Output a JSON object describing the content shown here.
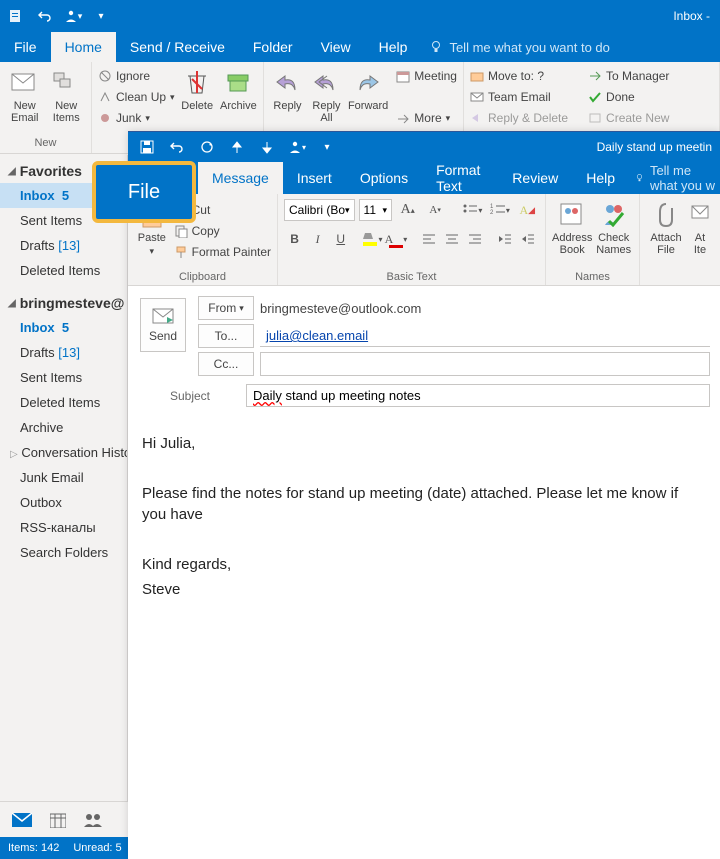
{
  "main_title": "Inbox - ",
  "main_tabs": {
    "file": "File",
    "home": "Home",
    "sendreceive": "Send / Receive",
    "folder": "Folder",
    "view": "View",
    "help": "Help",
    "tellme": "Tell me what you want to do"
  },
  "ribbon": {
    "new_email": "New\nEmail",
    "new_items": "New\nItems",
    "new": "New",
    "ignore": "Ignore",
    "cleanup": "Clean Up",
    "junk": "Junk",
    "delete": "Delete",
    "archive": "Archive",
    "reply": "Reply",
    "replyall": "Reply\nAll",
    "forward": "Forward",
    "meeting": "Meeting",
    "more": "More",
    "moveto": "Move to: ?",
    "teamemail": "Team Email",
    "replyd": "Reply & Delete",
    "tomanager": "To Manager",
    "done": "Done",
    "createnew": "Create New"
  },
  "sidebar": {
    "favorites": "Favorites",
    "inbox": "Inbox",
    "inbox_count": "5",
    "sent": "Sent Items",
    "drafts": "Drafts",
    "drafts_count": "[13]",
    "deleted": "Deleted Items",
    "account": "bringmesteve@",
    "archive": "Archive",
    "convhist": "Conversation Histor",
    "junk": "Junk Email",
    "outbox": "Outbox",
    "rss": "RSS-каналы",
    "search": "Search Folders"
  },
  "status": {
    "items": "Items: 142",
    "unread": "Unread: 5"
  },
  "callout": "File",
  "compose": {
    "title": "Daily stand up meetin",
    "tabs": {
      "file": "File",
      "message": "Message",
      "insert": "Insert",
      "options": "Options",
      "formattext": "Format Text",
      "review": "Review",
      "help": "Help",
      "tellme": "Tell me what you w"
    },
    "ribbon": {
      "paste": "Paste",
      "cut": "Cut",
      "copy": "Copy",
      "formatpainter": "Format Painter",
      "clipboard": "Clipboard",
      "font_name": "Calibri (Bo",
      "font_size": "11",
      "basictext": "Basic Text",
      "addressbook": "Address\nBook",
      "checknames": "Check\nNames",
      "names": "Names",
      "attachfile": "Attach\nFile",
      "attachitem": "At\nIte"
    },
    "header": {
      "send": "Send",
      "from_btn": "From",
      "from_val": "bringmesteve@outlook.com",
      "to_btn": "To...",
      "to_val": "julia@clean.email",
      "cc_btn": "Cc...",
      "subject_label": "Subject",
      "subject_val_wavy": "Daily",
      "subject_val_rest": " stand up meeting notes"
    },
    "body": {
      "l1": "Hi Julia,",
      "l2": "Please find the notes for stand up meeting (date) attached. Please let me know if you have",
      "l3": "Kind regards,",
      "l4": "Steve"
    }
  }
}
